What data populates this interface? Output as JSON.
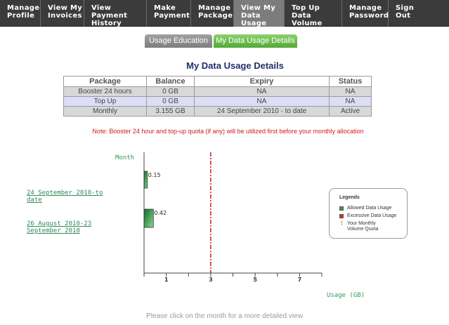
{
  "nav": [
    {
      "label": "Manage\nProfile",
      "active": false
    },
    {
      "label": "View My\nInvoices",
      "active": false
    },
    {
      "label": "View Payment\nHistory",
      "active": false
    },
    {
      "label": "Make\nPayment",
      "active": false
    },
    {
      "label": "Manage\nPackage",
      "active": false
    },
    {
      "label": "View My\nData Usage",
      "active": true
    },
    {
      "label": "Top Up\nData Volume",
      "active": false
    },
    {
      "label": "Manage\nPassword",
      "active": false
    },
    {
      "label": "Sign\nOut",
      "active": false
    }
  ],
  "tabs": {
    "education": "Usage Education",
    "details": "My Data Usage Details"
  },
  "page_title": "My Data Usage Details",
  "table": {
    "headers": [
      "Package",
      "Balance",
      "Expiry",
      "Status"
    ],
    "rows": [
      [
        "Booster 24 hours",
        "0 GB",
        "NA",
        "NA"
      ],
      [
        "Top Up",
        "0 GB",
        "NA",
        "NA"
      ],
      [
        "Monthly",
        "3.155 GB",
        "24 September 2010 - to date",
        "Active"
      ]
    ]
  },
  "note": "Note: Booster 24 hour and top-up quota (if any) will be utilized first before your monthly allocation",
  "chart_data": {
    "type": "bar",
    "orientation": "horizontal",
    "ylabel": "Month",
    "xlabel": "Usage (GB)",
    "xlim": [
      0,
      8
    ],
    "x_ticks": [
      "1",
      "3",
      "5",
      "7"
    ],
    "categories": [
      "24 September 2010-to date",
      "26 August 2010-23 September 2010"
    ],
    "values": [
      0.15,
      0.42
    ],
    "data_labels": [
      "0.15",
      "0.42"
    ],
    "quota_line": 3,
    "colors": {
      "allowed": "#3a9a4a",
      "excessive": "#cc3a1a",
      "quota": "#cc1b1b"
    },
    "legend": {
      "title": "Legends",
      "items": [
        "Allowed Data Usage",
        "Excessive Data Usage",
        "Your Monthly Volume Quota"
      ]
    }
  },
  "footer": "Please click on the month for a more detailed view"
}
